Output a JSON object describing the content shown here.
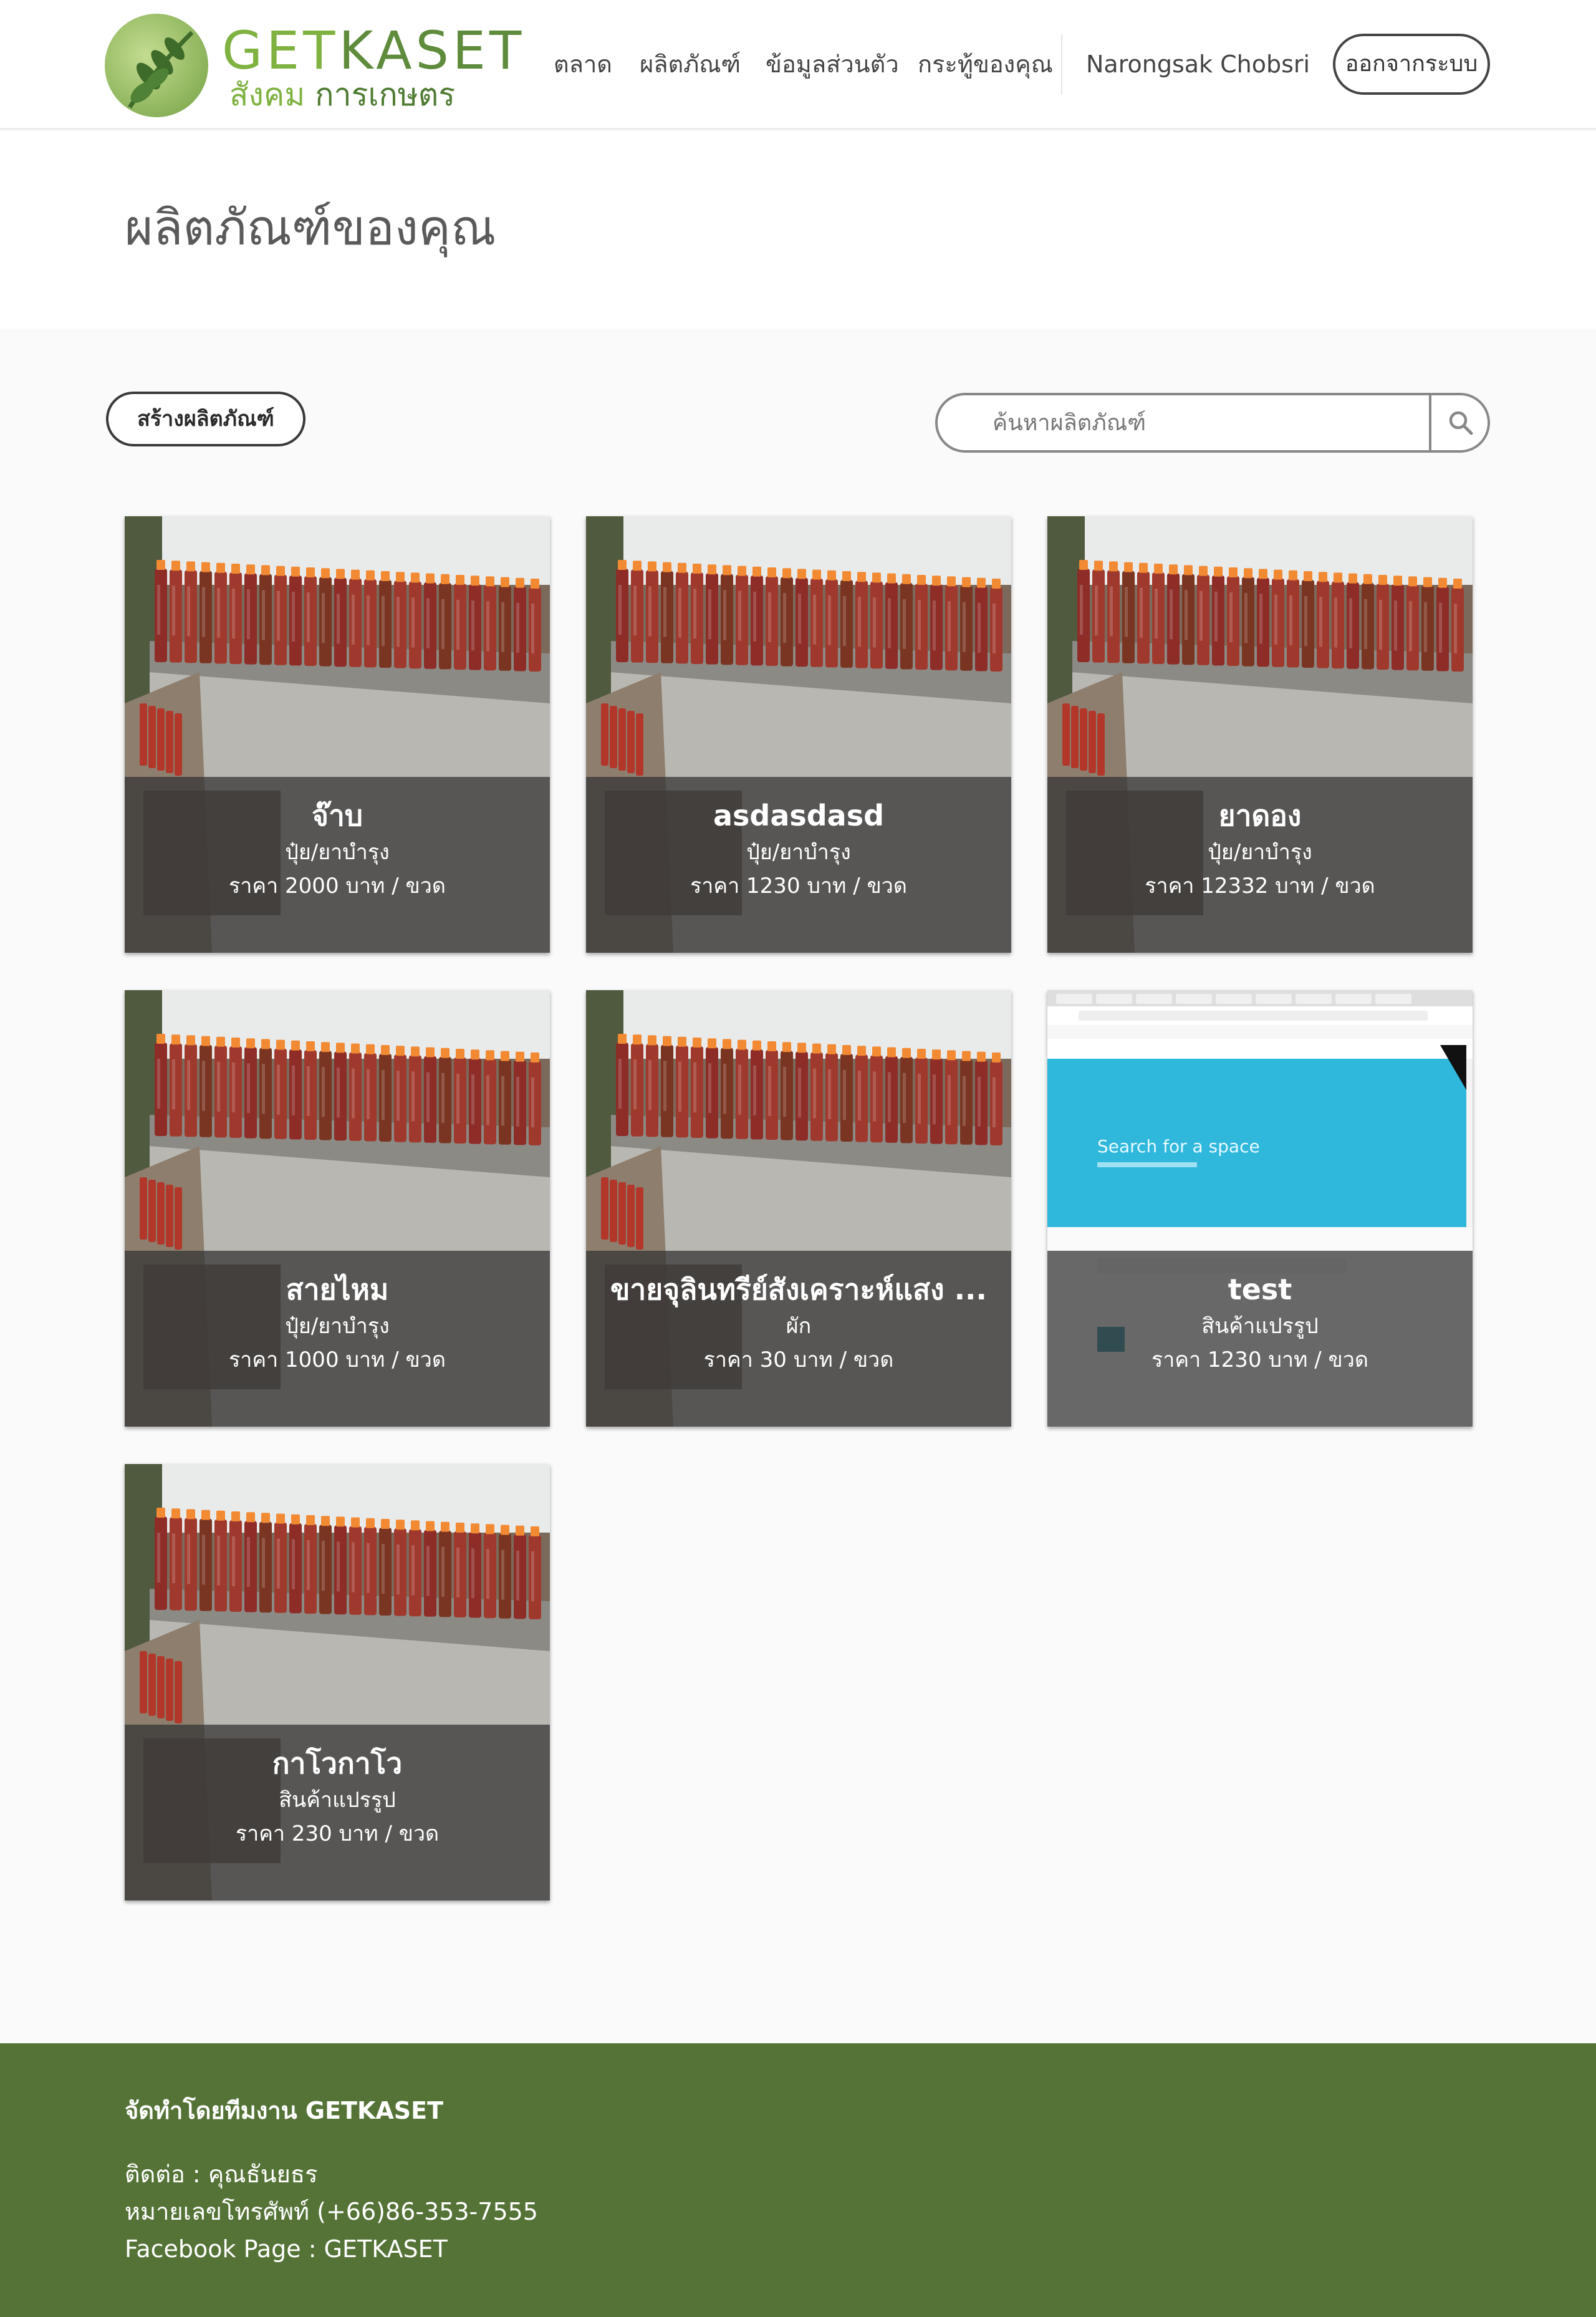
{
  "header": {
    "logo": {
      "title_part1": "GET",
      "title_part2": "KASET",
      "subtitle_part1": "สังคม ",
      "subtitle_part2": "การเกษตร"
    },
    "nav": [
      "ตลาด",
      "ผลิตภัณฑ์",
      "ข้อมูลส่วนตัว",
      "กระทู้ของคุณ"
    ],
    "user_name": "Narongsak Chobsri",
    "logout_label": "ออกจากระบบ"
  },
  "page": {
    "title": "ผลิตภัณฑ์ของคุณ"
  },
  "toolbar": {
    "create_label": "สร้างผลิตภัณฑ์",
    "search_placeholder": "ค้นหาผลิตภัณฑ์",
    "search_icon": "search-icon"
  },
  "products": [
    {
      "name": "จ๊าบ",
      "category": "ปุ๋ย/ยาบำรุง",
      "price": "ราคา 2000 บาท / ขวด",
      "image": "bottles-photo"
    },
    {
      "name": "asdasdasd",
      "category": "ปุ๋ย/ยาบำรุง",
      "price": "ราคา 1230 บาท / ขวด",
      "image": "bottles-photo"
    },
    {
      "name": "ยาดอง",
      "category": "ปุ๋ย/ยาบำรุง",
      "price": "ราคา 12332 บาท / ขวด",
      "image": "bottles-photo"
    },
    {
      "name": "สายไหม",
      "category": "ปุ๋ย/ยาบำรุง",
      "price": "ราคา 1000 บาท / ขวด",
      "image": "bottles-photo"
    },
    {
      "name": "ขายจุลินทรีย์สังเคราะห์แสง ...",
      "category": "ผัก",
      "price": "ราคา 30 บาท / ขวด",
      "image": "bottles-photo"
    },
    {
      "name": "test",
      "category": "สินค้าแปรรูป",
      "price": "ราคา 1230 บาท / ขวด",
      "image": "browser-screenshot"
    },
    {
      "name": "กาโวกาโว",
      "category": "สินค้าแปรรูป",
      "price": "ราคา 230 บาท / ขวด",
      "image": "bottles-photo"
    }
  ],
  "screenshot_thumb": {
    "search_text": "Search for a space"
  },
  "footer": {
    "title": "จัดทำโดยทีมงาน GETKASET",
    "contact": "ติดต่อ : คุณธันยธร",
    "phone": "หมายเลขโทรศัพท์ (+66)86-353-7555",
    "facebook": "Facebook Page : GETKASET"
  },
  "colors": {
    "footer_bg": "#557337",
    "brand_green": "#7fb241",
    "overlay": "rgba(52,52,52,0.74)"
  }
}
